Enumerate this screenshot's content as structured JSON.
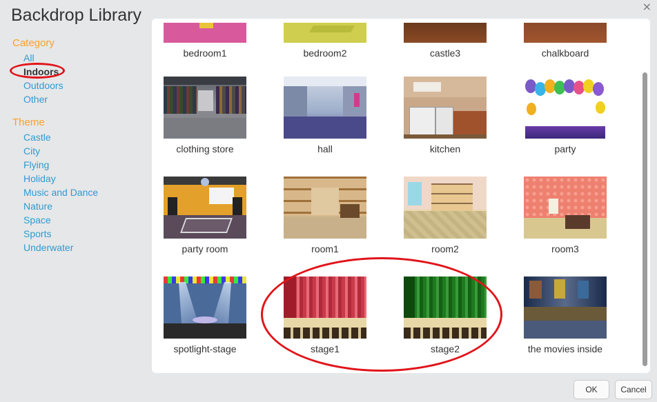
{
  "dialog": {
    "title": "Backdrop Library",
    "close_glyph": "×"
  },
  "sidebar": {
    "category_heading": "Category",
    "categories": [
      {
        "label": "All"
      },
      {
        "label": "Indoors",
        "selected": true
      },
      {
        "label": "Outdoors"
      },
      {
        "label": "Other"
      }
    ],
    "theme_heading": "Theme",
    "themes": [
      {
        "label": "Castle"
      },
      {
        "label": "City"
      },
      {
        "label": "Flying"
      },
      {
        "label": "Holiday"
      },
      {
        "label": "Music and Dance"
      },
      {
        "label": "Nature"
      },
      {
        "label": "Space"
      },
      {
        "label": "Sports"
      },
      {
        "label": "Underwater"
      }
    ]
  },
  "backdrops": [
    {
      "label": "bedroom1"
    },
    {
      "label": "bedroom2"
    },
    {
      "label": "castle3"
    },
    {
      "label": "chalkboard"
    },
    {
      "label": "clothing store"
    },
    {
      "label": "hall"
    },
    {
      "label": "kitchen"
    },
    {
      "label": "party"
    },
    {
      "label": "party room"
    },
    {
      "label": "room1"
    },
    {
      "label": "room2"
    },
    {
      "label": "room3"
    },
    {
      "label": "spotlight-stage"
    },
    {
      "label": "stage1"
    },
    {
      "label": "stage2"
    },
    {
      "label": "the movies inside"
    }
  ],
  "buttons": {
    "ok": "OK",
    "cancel": "Cancel"
  },
  "colors": {
    "accent_orange": "#f9a02a",
    "link_blue": "#2e9bd3",
    "annotation_red": "#e0141a"
  }
}
